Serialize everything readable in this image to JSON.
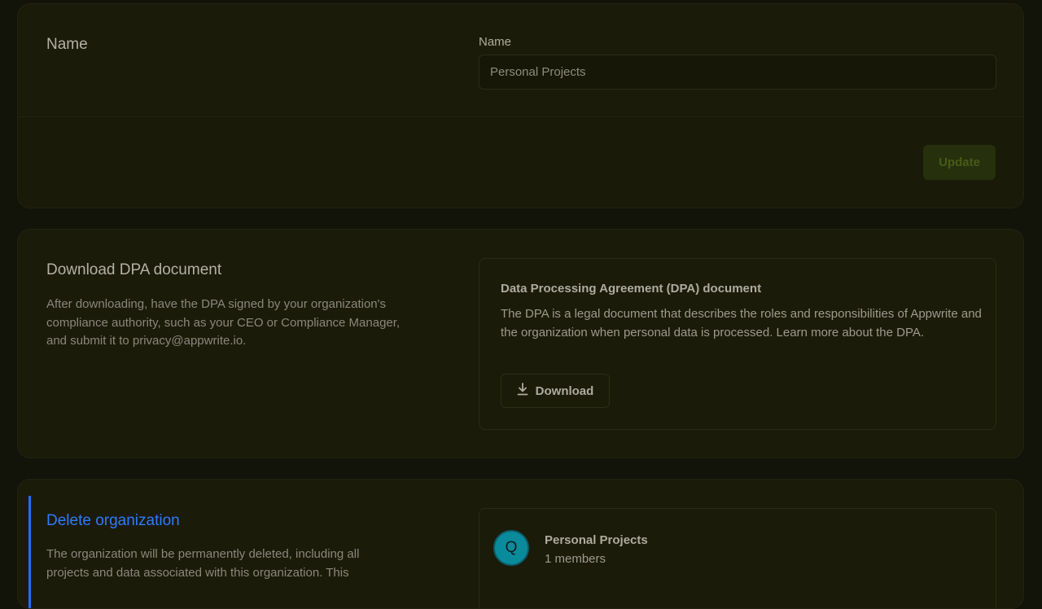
{
  "name_section": {
    "title": "Name",
    "field_label": "Name",
    "field_value": "Personal Projects",
    "update_label": "Update"
  },
  "dpa_section": {
    "title": "Download DPA document",
    "description": "After downloading, have the DPA signed by your organization's compliance authority, such as your CEO or Compliance Manager, and submit it to privacy@appwrite.io.",
    "box_title": "Data Processing Agreement (DPA) document",
    "box_text": "The DPA is a legal document that describes the roles and responsibilities of Appwrite and the organization when personal data is processed. Learn more about the DPA.",
    "download_label": "Download",
    "download_icon": "download-icon"
  },
  "delete_section": {
    "title": "Delete organization",
    "description": "The organization will be permanently deleted, including all projects and data associated with this organization. This",
    "org_initial": "Q",
    "org_name": "Personal Projects",
    "org_members": "1 members"
  },
  "colors": {
    "background": "#121309",
    "card": "#1b1b0a",
    "danger_title": "#2e7bff",
    "avatar": "#0a8b9c"
  }
}
